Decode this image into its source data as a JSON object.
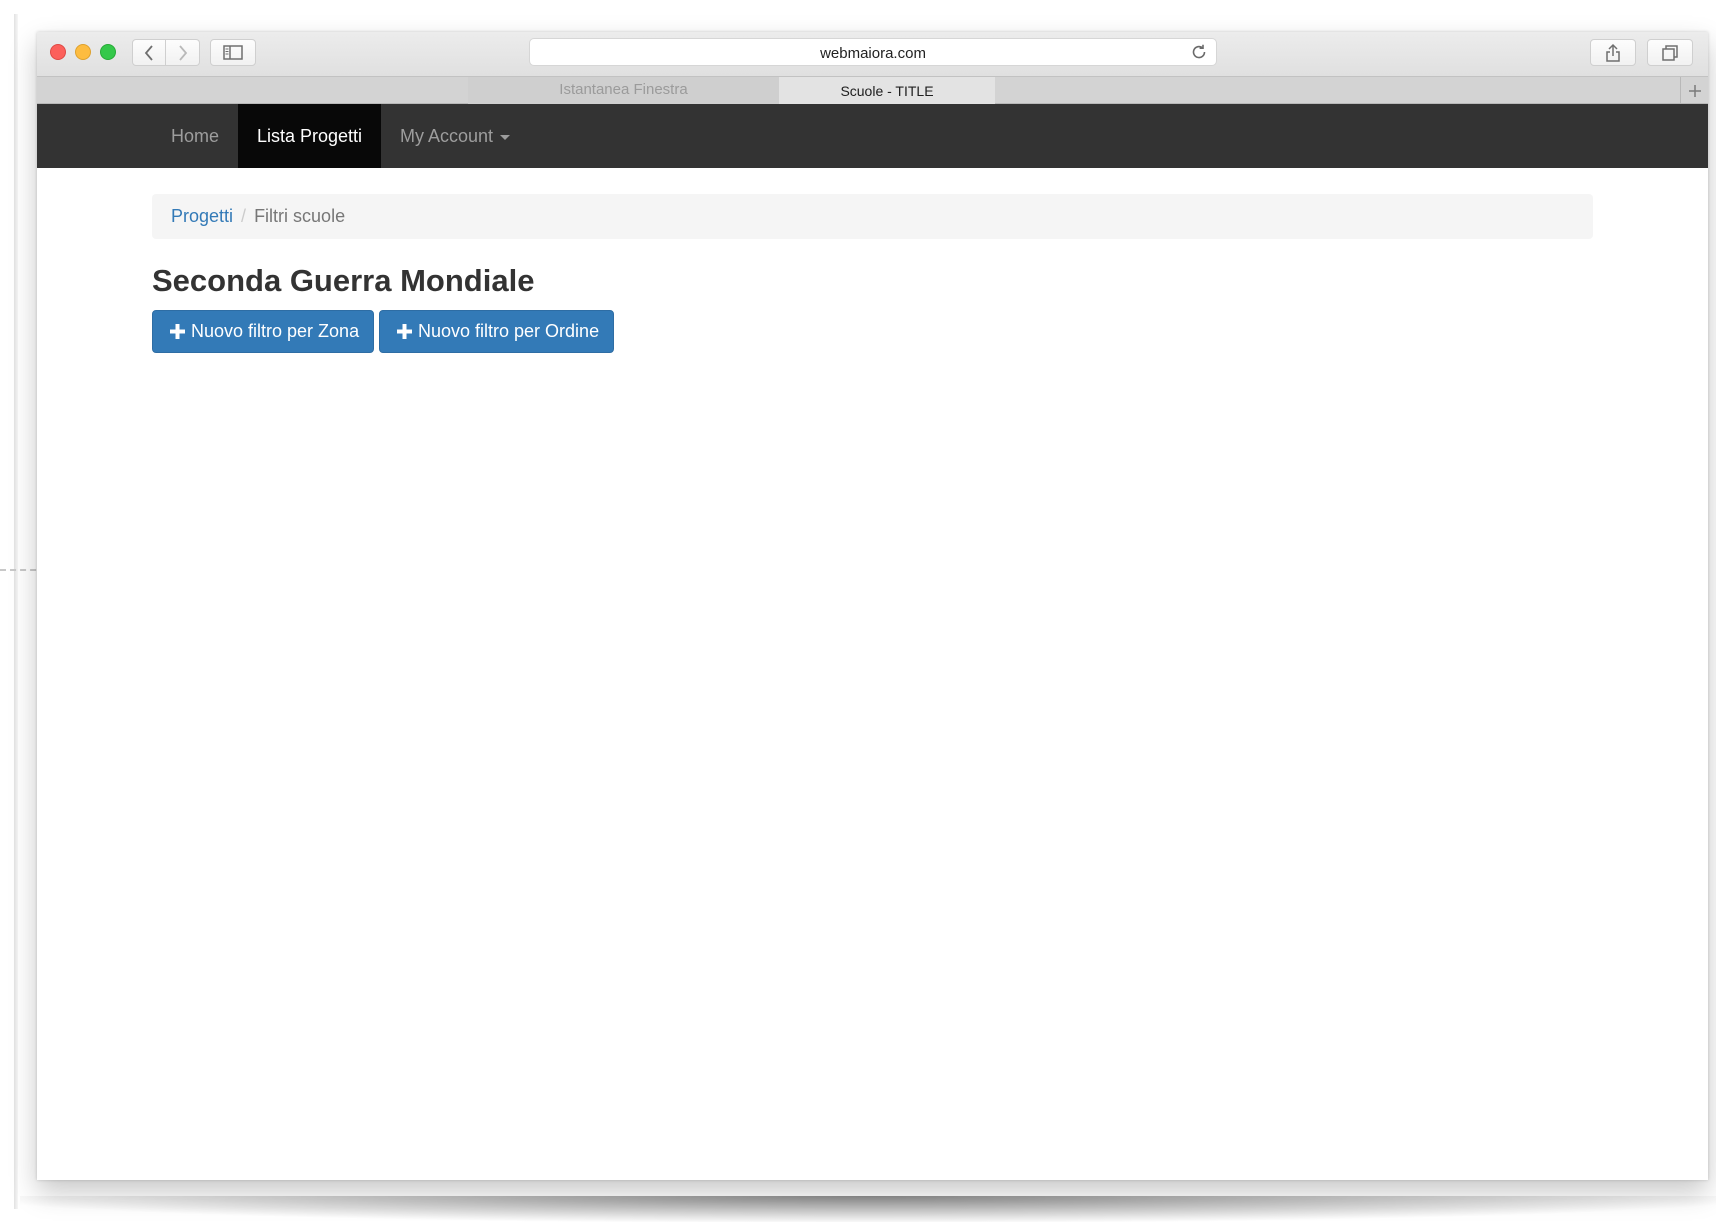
{
  "browser": {
    "url": "webmaiora.com",
    "tabs": [
      {
        "label": "Istantanea Finestra",
        "active": false
      },
      {
        "label": "Scuole - TITLE",
        "active": true
      }
    ],
    "icons": {
      "back": "chevron-left-icon",
      "forward": "chevron-right-icon",
      "sidebar": "sidebar-icon",
      "reload": "reload-icon",
      "share": "share-icon",
      "tabs": "tab-overview-icon",
      "new_tab": "plus-icon"
    },
    "colors": {
      "close": "#fc605b",
      "minimize": "#fdbc40",
      "zoom": "#34c84a"
    }
  },
  "navbar": {
    "items": [
      {
        "label": "Home",
        "active": false
      },
      {
        "label": "Lista Progetti",
        "active": true
      },
      {
        "label": "My Account",
        "active": false,
        "dropdown": true
      }
    ],
    "background": "#333333"
  },
  "breadcrumb": {
    "items": [
      {
        "label": "Progetti",
        "link": true
      },
      {
        "label": "Filtri scuole",
        "link": false
      }
    ],
    "separator": "/"
  },
  "page": {
    "title": "Seconda Guerra Mondiale"
  },
  "actions": {
    "buttons": [
      {
        "label": "Nuovo filtro per Zona",
        "icon": "plus-icon"
      },
      {
        "label": "Nuovo filtro per Ordine",
        "icon": "plus-icon"
      }
    ],
    "color": "#337ab7"
  }
}
